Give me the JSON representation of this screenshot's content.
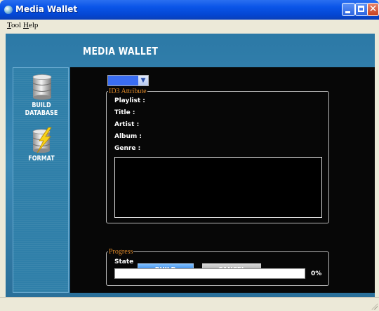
{
  "window": {
    "title": "Media Wallet"
  },
  "menu": [
    {
      "label": "Tool"
    },
    {
      "label": "Help"
    }
  ],
  "header": {
    "title": "MEDIA WALLET"
  },
  "sidebar": {
    "items": [
      {
        "label": "BUILD DATABASE",
        "icon": "database-icon"
      },
      {
        "label": "FORMAT",
        "icon": "format-lightning-icon"
      }
    ]
  },
  "id3": {
    "legend": "ID3 Attribute",
    "dropdown_value": "",
    "fields": [
      {
        "label": "Playlist :",
        "value": ""
      },
      {
        "label": "Title :",
        "value": ""
      },
      {
        "label": "Artist :",
        "value": ""
      },
      {
        "label": "Album :",
        "value": ""
      },
      {
        "label": "Genre :",
        "value": ""
      }
    ]
  },
  "buttons": {
    "build": "BUILD",
    "cancel": "CANCEL"
  },
  "progress": {
    "legend": "Progress",
    "state_label": "State",
    "percent_text": "0%",
    "fraction": 0
  },
  "colors": {
    "accent_blue": "#2a7be0",
    "legend_orange": "#e08a2a",
    "panel_bg": "#2c79a6",
    "main_bg": "#070707"
  }
}
